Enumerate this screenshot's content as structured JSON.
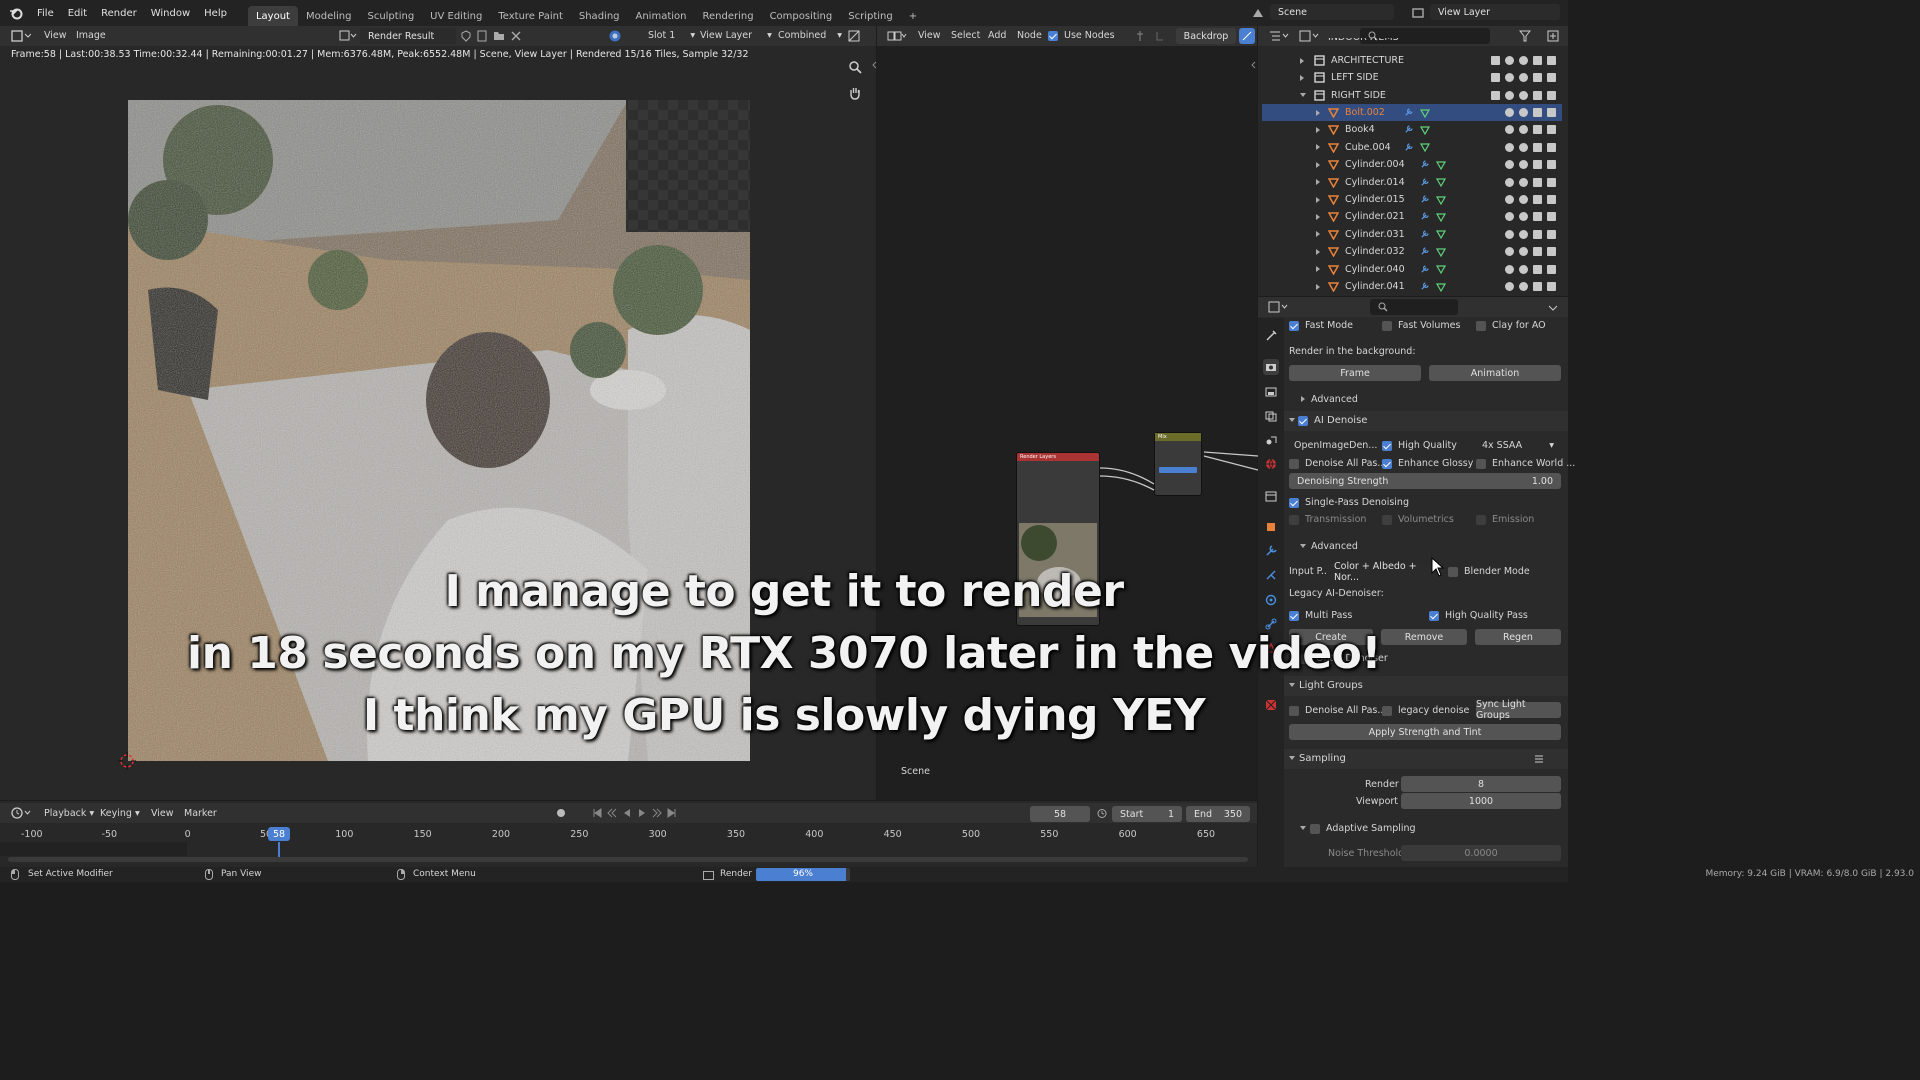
{
  "topbar": {
    "menus": [
      "File",
      "Edit",
      "Render",
      "Window",
      "Help"
    ],
    "workspaces": [
      "Layout",
      "Modeling",
      "Sculpting",
      "UV Editing",
      "Texture Paint",
      "Shading",
      "Animation",
      "Rendering",
      "Compositing",
      "Scripting"
    ],
    "active_workspace": "Layout",
    "add_tab": "+",
    "scene": "Scene",
    "view_layer": "View Layer"
  },
  "image_editor": {
    "menus": [
      "View",
      "Image"
    ],
    "image_name": "Render Result",
    "slot": "Slot 1",
    "layer": "View Layer",
    "pass": "Combined",
    "status": "Frame:58 | Last:00:38.53 Time:00:32.44 | Remaining:00:01.27 | Mem:6376.48M, Peak:6552.48M | Scene, View Layer | Rendered 15/16 Tiles, Sample 32/32"
  },
  "node_editor": {
    "menus": [
      "View",
      "Select",
      "Add",
      "Node"
    ],
    "use_nodes": "Use Nodes",
    "backdrop": "Backdrop",
    "scene_label": "Scene",
    "node1_title": "Render Layers",
    "node2_title": "Mix"
  },
  "outliner": {
    "top_partial": "INDOOR ITEMS",
    "collections": [
      "ARCHITECTURE",
      "LEFT SIDE",
      "RIGHT SIDE"
    ],
    "objects": [
      "Bolt.002",
      "Book4",
      "Cube.004",
      "Cylinder.004",
      "Cylinder.014",
      "Cylinder.015",
      "Cylinder.021",
      "Cylinder.031",
      "Cylinder.032",
      "Cylinder.040",
      "Cylinder.041"
    ],
    "selected": "Bolt.002"
  },
  "properties": {
    "fast_mode": "Fast Mode",
    "fast_volumes": "Fast Volumes",
    "clay_for_ao": "Clay for AO",
    "render_bg_label": "Render in the background:",
    "frame_btn": "Frame",
    "animation_btn": "Animation",
    "advanced": "Advanced",
    "ai_denoise": "AI Denoise",
    "denoiser": "OpenImageDen...",
    "high_quality": "High Quality",
    "ssaa": "4x SSAA",
    "denoise_all_passes": "Denoise All Pas...",
    "enhance_glossy": "Enhance Glossy",
    "enhance_world": "Enhance World ...",
    "denoising_strength_label": "Denoising Strength",
    "denoising_strength_value": "1.00",
    "single_pass": "Single-Pass Denoising",
    "transmission": "Transmission",
    "volumetrics": "Volumetrics",
    "emission": "Emission",
    "advanced2": "Advanced",
    "input_passes_label": "Input P...",
    "input_passes_value": "Color + Albedo + Nor...",
    "blender_mode": "Blender Mode",
    "legacy_label": "Legacy AI-Denoiser:",
    "multi_pass": "Multi Pass",
    "high_quality_pass": "High Quality Pass",
    "create_btn": "Create",
    "remove_btn": "Remove",
    "regen_btn": "Regen",
    "optix_denoiser": "OptiX Denoiser",
    "light_groups": "Light Groups",
    "denoise_all_pas2": "Denoise All Pas...",
    "legacy_denoise": "legacy denoise",
    "sync_light_groups": "Sync Light Groups",
    "apply_strength": "Apply Strength and Tint",
    "sampling": "Sampling",
    "render_label": "Render",
    "render_value": "8",
    "viewport_label": "Viewport",
    "viewport_value": "1000",
    "adaptive_sampling": "Adaptive Sampling",
    "noise_threshold_label": "Noise Threshold",
    "noise_threshold_value": "0.0000"
  },
  "timeline": {
    "menus": [
      "Playback",
      "Keying",
      "View",
      "Marker"
    ],
    "current_frame": "58",
    "start_label": "Start",
    "start_value": "1",
    "end_label": "End",
    "end_value": "350",
    "ticks": [
      "-100",
      "-50",
      "0",
      "50",
      "100",
      "150",
      "200",
      "250",
      "300",
      "350",
      "400",
      "450",
      "500",
      "550",
      "600",
      "650"
    ],
    "playhead": "58"
  },
  "statusbar": {
    "set_active_modifier": "Set Active Modifier",
    "pan_view": "Pan View",
    "context_menu": "Context Menu",
    "render_label": "Render",
    "render_progress": 0.96,
    "render_progress_text": "96%",
    "memory": "Memory: 9.24 GiB | VRAM: 6.9/8.0 GiB | 2.93.0"
  },
  "subtitles": [
    "I manage to get it to render",
    "in 18 seconds on my RTX 3070 later in the video!",
    "I think my GPU is  slowly dying YEY"
  ],
  "colors": {
    "accent_blue": "#4a7fd1",
    "selected_row": "#334d80",
    "object_orange": "#e8823a",
    "collection_white": "#e0e0e0"
  }
}
